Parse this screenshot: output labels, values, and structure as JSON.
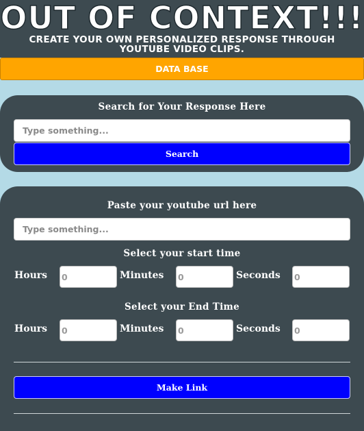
{
  "header": {
    "title": "OUT OF CONTEXT!!!",
    "subtitle": "CREATE YOUR OWN PERSONALIZED RESPONSE THROUGH YOUTUBE VIDEO CLIPS."
  },
  "database_button": {
    "label": "DATA BASE"
  },
  "search_section": {
    "heading": "Search for Your Response Here",
    "input": {
      "placeholder": "Type something...",
      "value": ""
    },
    "button_label": "Search"
  },
  "link_section": {
    "url_heading": "Paste your youtube url here",
    "url_input": {
      "placeholder": "Type something...",
      "value": ""
    },
    "start": {
      "heading": "Select your start time",
      "hours_label": "Hours",
      "minutes_label": "Minutes",
      "seconds_label": "Seconds",
      "hours_placeholder": "0",
      "minutes_placeholder": "0",
      "seconds_placeholder": "0"
    },
    "end": {
      "heading": "Select your End Time",
      "hours_label": "Hours",
      "minutes_label": "Minutes",
      "seconds_label": "Seconds",
      "hours_placeholder": "0",
      "minutes_placeholder": "0",
      "seconds_placeholder": "0"
    },
    "make_link_label": "Make Link"
  },
  "colors": {
    "page_background": "#b4dae6",
    "panel": "#3d4a50",
    "accent_orange": "#ffa500",
    "button_blue": "#0000ff",
    "text": "#ffffff"
  }
}
